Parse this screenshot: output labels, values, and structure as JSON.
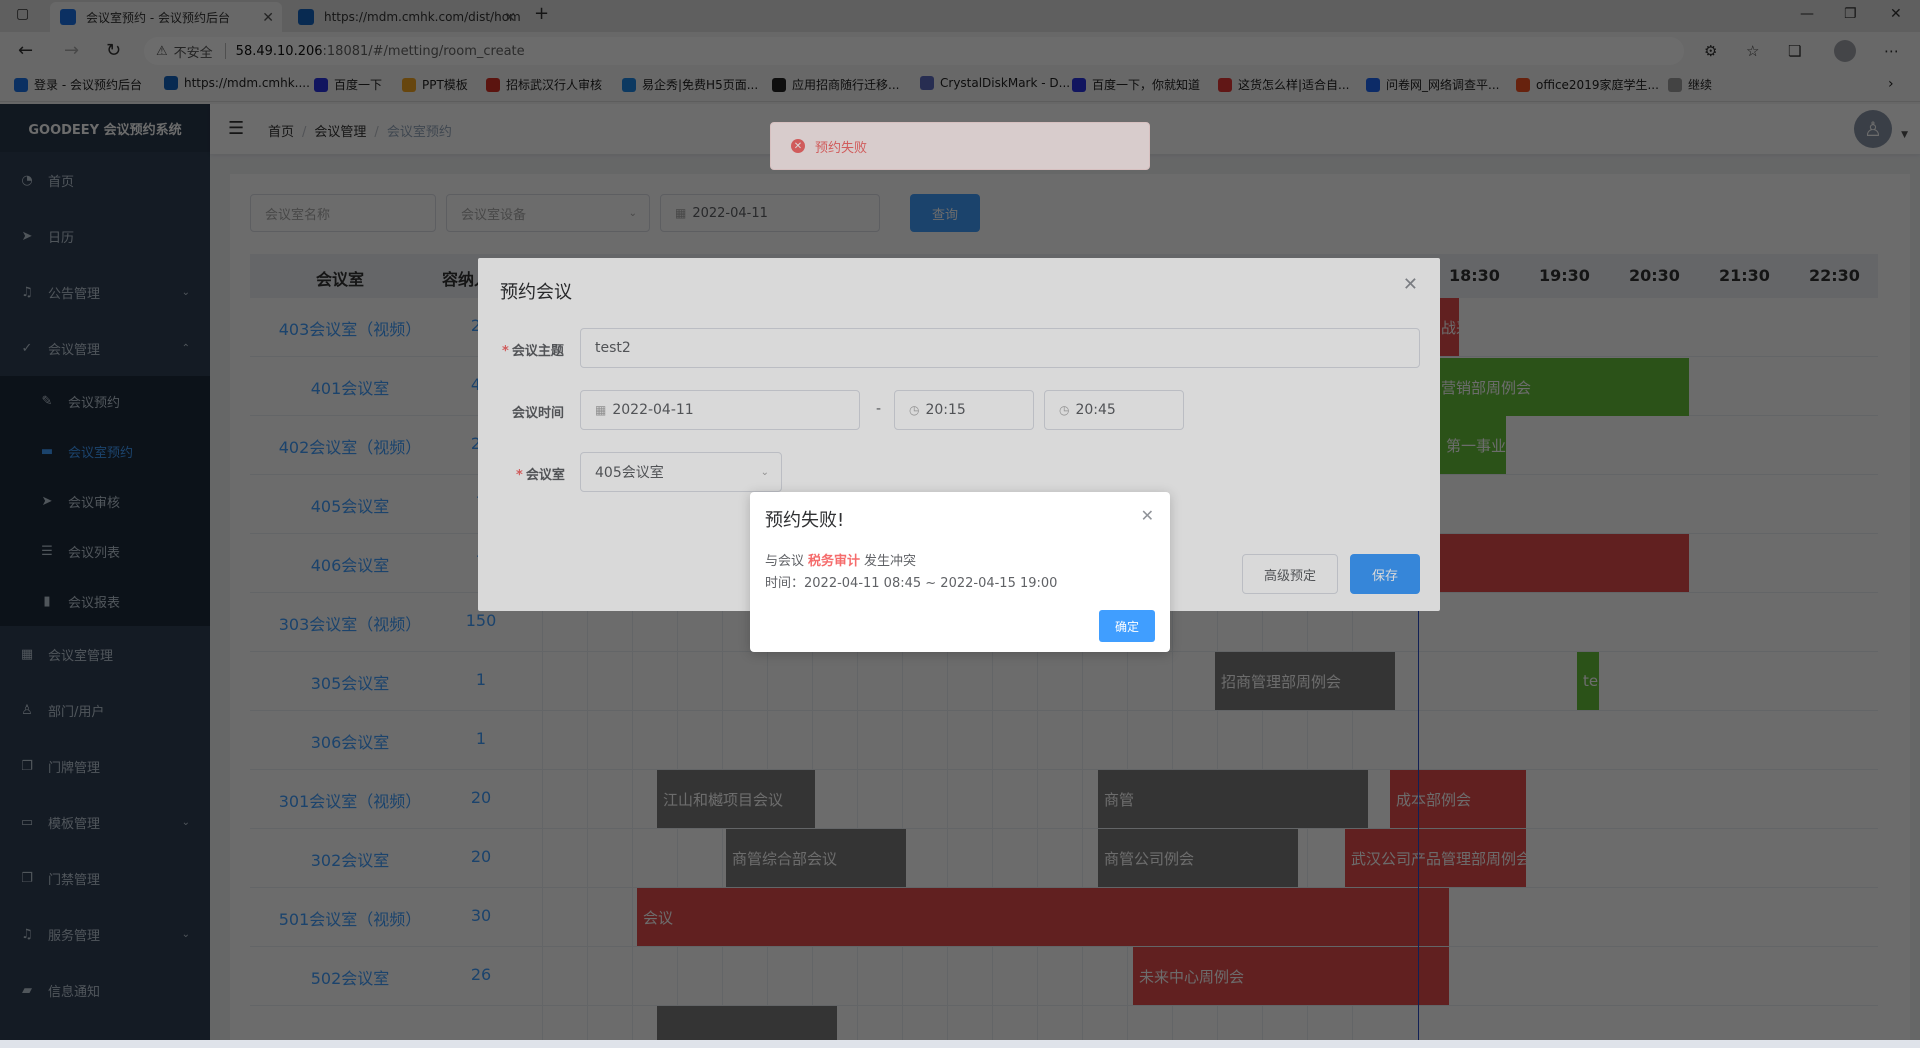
{
  "browser": {
    "tabs": [
      {
        "title": "会议室预约 - 会议预约后台",
        "active": true
      },
      {
        "title": "https://mdm.cmhk.com/dist/hom",
        "active": false
      }
    ],
    "new_tab": "+",
    "url": {
      "insecure_label": "不安全",
      "host": "58.49.10.206",
      "path": ":18081/#/metting/room_create"
    },
    "bookmarks": [
      {
        "label": "登录 - 会议预约后台",
        "color": "#1a73e8"
      },
      {
        "label": "https://mdm.cmhk....",
        "color": "#1565c0"
      },
      {
        "label": "百度一下",
        "color": "#2932e1"
      },
      {
        "label": "PPT模板",
        "color": "#f5a623"
      },
      {
        "label": "招标武汉行人审核",
        "color": "#d93025"
      },
      {
        "label": "易企秀|免费H5页面...",
        "color": "#1e88e5"
      },
      {
        "label": "应用招商随行迁移...",
        "color": "#222222"
      },
      {
        "label": "CrystalDiskMark - D...",
        "color": "#5c6bc0"
      },
      {
        "label": "百度一下，你就知道",
        "color": "#2932e1"
      },
      {
        "label": "这货怎么样|适合自...",
        "color": "#e53935"
      },
      {
        "label": "问卷网_网络调查平...",
        "color": "#1e66f5"
      },
      {
        "label": "office2019家庭学生...",
        "color": "#f25022"
      },
      {
        "label": "继续",
        "color": "#9e9e9e"
      }
    ]
  },
  "sidebar": {
    "brand": "GOODEEY 会议预约系统",
    "items": [
      {
        "label": "首页",
        "icon": "dashboard-icon",
        "glyph": "◔"
      },
      {
        "label": "日历",
        "icon": "send-icon",
        "glyph": "➤"
      },
      {
        "label": "公告管理",
        "icon": "bell-icon",
        "glyph": "♫",
        "arrow": "⌄"
      },
      {
        "label": "会议管理",
        "icon": "check-icon",
        "glyph": "✓",
        "arrow": "⌃"
      }
    ],
    "sub_items": [
      {
        "label": "会议预约",
        "icon": "edit-icon",
        "glyph": "✎"
      },
      {
        "label": "会议室预约",
        "icon": "monitor-icon",
        "glyph": "▬",
        "active": true
      },
      {
        "label": "会议审核",
        "icon": "plane-icon",
        "glyph": "➤"
      },
      {
        "label": "会议列表",
        "icon": "list-icon",
        "glyph": "☰"
      },
      {
        "label": "会议报表",
        "icon": "chart-icon",
        "glyph": "▮"
      }
    ],
    "items2": [
      {
        "label": "会议室管理",
        "icon": "table-icon",
        "glyph": "▦"
      },
      {
        "label": "部门/用户",
        "icon": "user-icon",
        "glyph": "♙"
      },
      {
        "label": "门牌管理",
        "icon": "copy-icon",
        "glyph": "❐"
      },
      {
        "label": "模板管理",
        "icon": "bag-icon",
        "glyph": "▭",
        "arrow": "⌄"
      },
      {
        "label": "门禁管理",
        "icon": "copy-icon",
        "glyph": "❐"
      },
      {
        "label": "服务管理",
        "icon": "bell-icon",
        "glyph": "♫",
        "arrow": "⌄"
      },
      {
        "label": "信息通知",
        "icon": "message-icon",
        "glyph": "▰"
      }
    ]
  },
  "navbar": {
    "breadcrumb": [
      "首页",
      "会议管理",
      "会议室预约"
    ]
  },
  "filters": {
    "name_placeholder": "会议室名称",
    "device_placeholder": "会议室设备",
    "date": "2022-04-11",
    "query": "查询"
  },
  "grid": {
    "headers": {
      "room": "会议室",
      "capacity": "容纳人数"
    },
    "times": [
      "18:30",
      "19:30",
      "20:30",
      "21:30",
      "22:30"
    ],
    "rows": [
      {
        "name": "403会议室（视频）",
        "cap": "20"
      },
      {
        "name": "401会议室",
        "cap": "40"
      },
      {
        "name": "402会议室（视频）",
        "cap": "20"
      },
      {
        "name": "405会议室",
        "cap": "7"
      },
      {
        "name": "406会议室",
        "cap": "7"
      },
      {
        "name": "303会议室（视频）",
        "cap": "150"
      },
      {
        "name": "305会议室",
        "cap": "1"
      },
      {
        "name": "306会议室",
        "cap": "1"
      },
      {
        "name": "301会议室（视频）",
        "cap": "20"
      },
      {
        "name": "302会议室",
        "cap": "20"
      },
      {
        "name": "501会议室（视频）",
        "cap": "30"
      },
      {
        "name": "502会议室",
        "cap": "26"
      }
    ],
    "events": [
      {
        "label": "战采购",
        "color": "#e74c4c"
      },
      {
        "label": "营销部周例会",
        "color": "#67c23a"
      },
      {
        "label": "第一事业",
        "color": "#67c23a"
      },
      {
        "label": "",
        "color": "#e74c4c"
      },
      {
        "label": "招商管理部周例会",
        "color": "#7d7d7d"
      },
      {
        "label": "test",
        "color": "#67c23a"
      },
      {
        "label": "江山和樾项目会议",
        "color": "#7d7d7d"
      },
      {
        "label": "商管",
        "color": "#7d7d7d"
      },
      {
        "label": "成本部例会",
        "color": "#e74c4c"
      },
      {
        "label": "商管综合部会议",
        "color": "#7d7d7d"
      },
      {
        "label": "商管公司例会",
        "color": "#7d7d7d"
      },
      {
        "label": "武汉公司产品管理部周例会",
        "color": "#e74c4c"
      },
      {
        "label": "会议",
        "color": "#e74c4c"
      },
      {
        "label": "未来中心周例会",
        "color": "#e74c4c"
      },
      {
        "label": "",
        "color": "#7d7d7d"
      }
    ]
  },
  "dialog": {
    "title": "预约会议",
    "subject_label": "会议主题",
    "subject_value": "test2",
    "time_label": "会议时间",
    "date_value": "2022-04-11",
    "dash": "-",
    "start_time": "20:15",
    "end_time": "20:45",
    "room_label": "会议室",
    "room_value": "405会议室",
    "advanced": "高级预定",
    "save": "保存"
  },
  "message": {
    "text": "预约失败"
  },
  "alert": {
    "title": "预约失败!",
    "line1_prefix": "与会议",
    "meeting": "税务审计",
    "line1_suffix": "发生冲突",
    "line2": "时间：2022-04-11 08:45 ~ 2022-04-15 19:00",
    "ok": "确定"
  }
}
